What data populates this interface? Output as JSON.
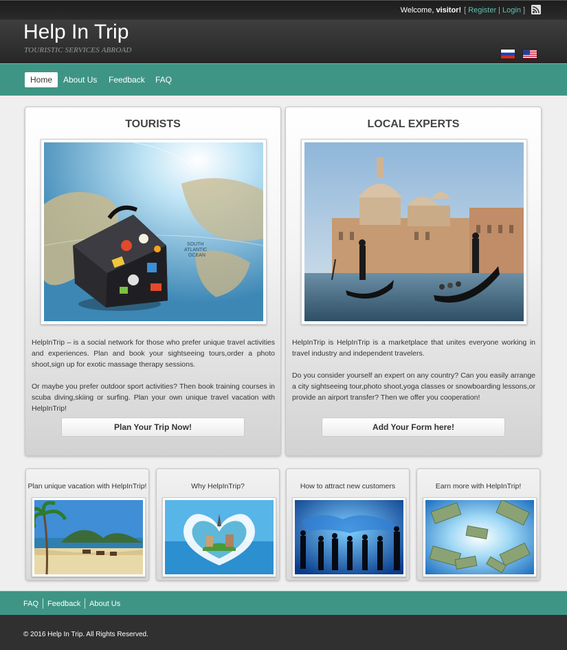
{
  "header": {
    "welcome": "Welcome,",
    "user": "visitor!",
    "bracket_open": "[",
    "register": "Register",
    "pipe": "|",
    "login": "Login",
    "bracket_close": "]",
    "title": "Help In Trip",
    "subtitle": "TOURISTIC SERVICES ABROAD"
  },
  "nav": [
    {
      "label": "Home",
      "active": true
    },
    {
      "label": "About Us",
      "active": false
    },
    {
      "label": "Feedback",
      "active": false
    },
    {
      "label": "FAQ",
      "active": false
    }
  ],
  "tourists": {
    "heading": "TOURISTS",
    "para1": "HelpInTrip – is a social network for those who prefer unique travel activities and experiences. Plan and book your sightseeing tours,order a photo shoot,sign up for exotic massage therapy sessions.",
    "para2": "Or maybe you prefer outdoor sport activities? Then book training courses in scuba diving,skiing or surfing. Plan your own unique travel vacation with HelpInTrip!",
    "button": "Plan Your Trip Now!",
    "map_label_1": "SOUTH",
    "map_label_2": "ATLANTIC",
    "map_label_3": "OCEAN"
  },
  "experts": {
    "heading": "LOCAL EXPERTS",
    "para1": "HelpInTrip is HelpInTrip is a marketplace that unites everyone working in travel industry and independent travelers.",
    "para2": "Do you consider yourself an expert on any country? Can you easily arrange a city sightseeing tour,photo shoot,yoga classes or snowboarding lessons,or provide an airport transfer? Then we offer you cooperation!",
    "button": "Add Your Form here!"
  },
  "cards": [
    {
      "title": "Plan unique vacation with HelpInTrip!"
    },
    {
      "title": "Why HelpInTrip?"
    },
    {
      "title": "How to attract new customers"
    },
    {
      "title": "Earn more with HelpInTrip!"
    }
  ],
  "footer": {
    "links": [
      "FAQ",
      "Feedback",
      "About Us"
    ],
    "copyright": "© 2016 Help In Trip. All Rights Reserved."
  },
  "colors": {
    "teal": "#3e9585",
    "header_dark": "#2a2a2a",
    "link": "#5fc2b3"
  },
  "icons": [
    "rss-icon",
    "flag-ru-icon",
    "flag-us-icon"
  ]
}
